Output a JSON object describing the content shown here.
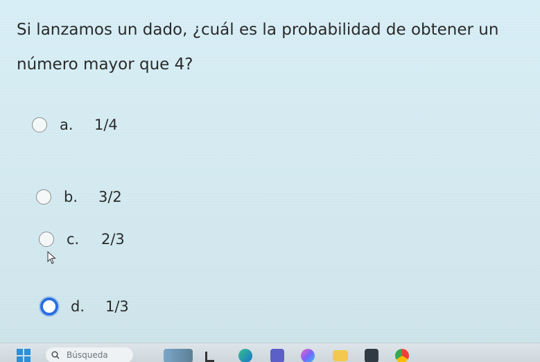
{
  "question": {
    "text": "Si lanzamos un dado, ¿cuál es la probabilidad de obtener un número mayor que 4?"
  },
  "options": [
    {
      "letter": "a.",
      "value": "1/4",
      "selected": false
    },
    {
      "letter": "b.",
      "value": "3/2",
      "selected": false
    },
    {
      "letter": "c.",
      "value": "2/3",
      "selected": false
    },
    {
      "letter": "d.",
      "value": "1/3",
      "selected": true
    }
  ],
  "taskbar": {
    "search_placeholder": "Búsqueda",
    "icons": [
      "windows-start-icon",
      "search-icon",
      "widgets-icon",
      "task-view-icon",
      "edge-icon",
      "teams-icon",
      "copilot-icon",
      "file-explorer-icon",
      "camera-icon",
      "chrome-icon"
    ]
  },
  "colors": {
    "background": "#d3eaf1",
    "selected_radio": "#2a6fe0",
    "text": "#2a2a2a"
  }
}
